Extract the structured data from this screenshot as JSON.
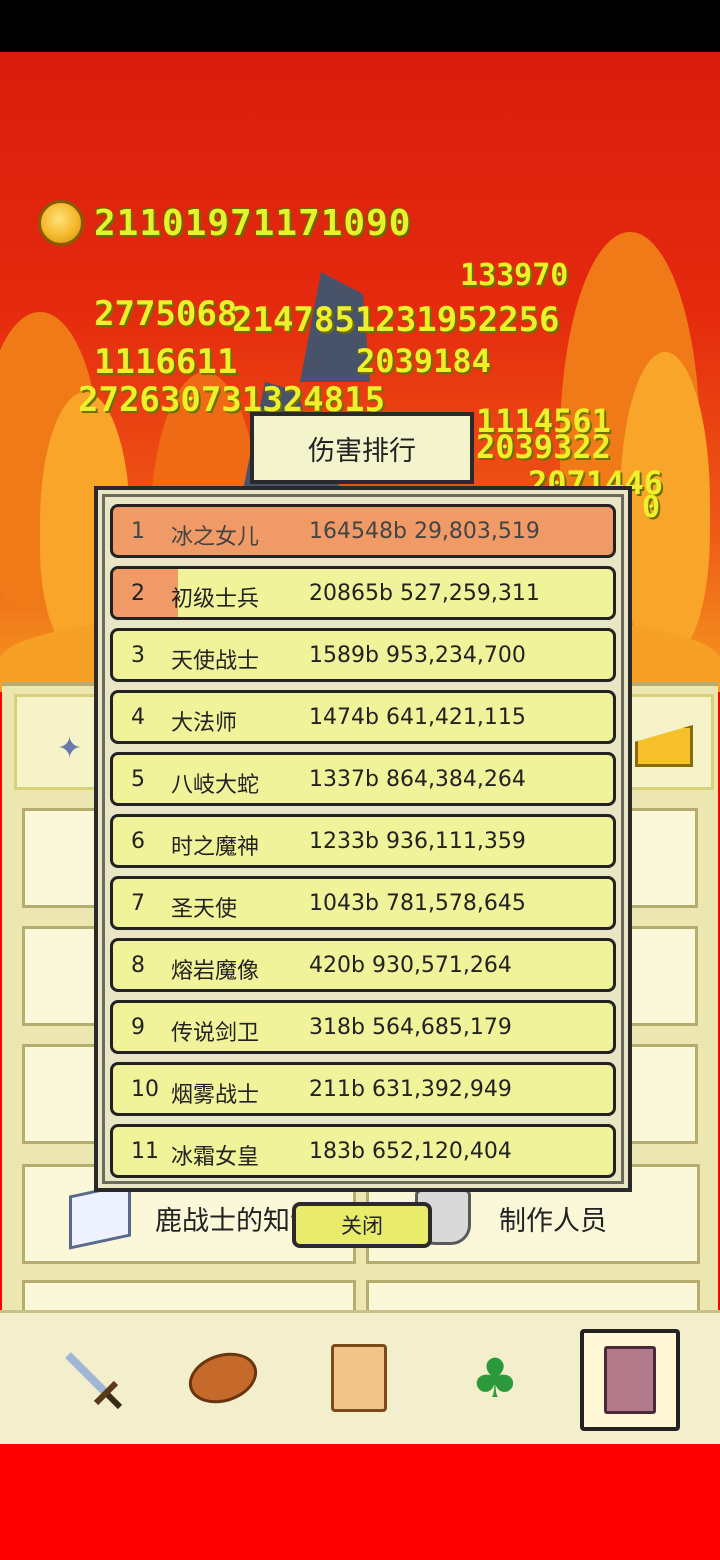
{
  "gold": "21101971171090",
  "damage_numbers": [
    "133970",
    "2775068",
    "2147851231952256",
    "1116611",
    "2039184",
    "272630731324815",
    "1114561",
    "2039322",
    "2071446",
    "0"
  ],
  "dialog": {
    "title": "伤害排行",
    "close_label": "关闭",
    "rows": [
      {
        "rank": "1",
        "name": "冰之女儿",
        "value": "164548b 29,803,519"
      },
      {
        "rank": "2",
        "name": "初级士兵",
        "value": "20865b 527,259,311"
      },
      {
        "rank": "3",
        "name": "天使战士",
        "value": "1589b 953,234,700"
      },
      {
        "rank": "4",
        "name": "大法师",
        "value": "1474b 641,421,115"
      },
      {
        "rank": "5",
        "name": "八岐大蛇",
        "value": "1337b 864,384,264"
      },
      {
        "rank": "6",
        "name": "时之魔神",
        "value": "1233b 936,111,359"
      },
      {
        "rank": "7",
        "name": "圣天使",
        "value": "1043b 781,578,645"
      },
      {
        "rank": "8",
        "name": "熔岩魔像",
        "value": "420b 930,571,264"
      },
      {
        "rank": "9",
        "name": "传说剑卫",
        "value": "318b 564,685,179"
      },
      {
        "rank": "10",
        "name": "烟雾战士",
        "value": "211b 631,392,949"
      },
      {
        "rank": "11",
        "name": "冰霜女皇",
        "value": "183b 652,120,404"
      }
    ],
    "row2_bar_fraction": 0.13
  },
  "menu": {
    "left_label": "鹿战士的知识",
    "right_label": "制作人员"
  },
  "nav": {
    "items": [
      "sword-icon",
      "bread-icon",
      "scroll-icon",
      "clover-icon",
      "book-icon"
    ],
    "selected": 4
  }
}
